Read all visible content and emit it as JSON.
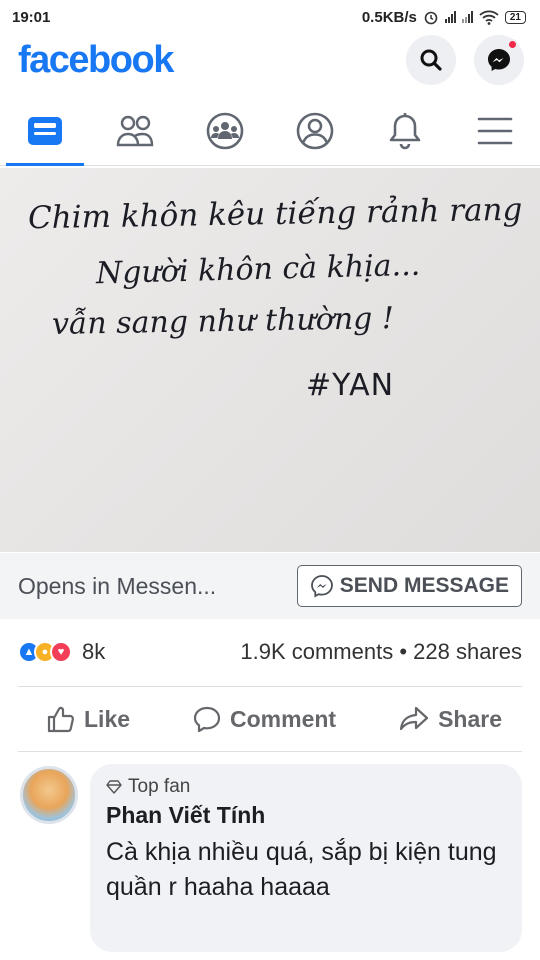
{
  "status_bar": {
    "time": "19:01",
    "speed": "0.5KB/s",
    "battery": "21"
  },
  "header": {
    "logo": "facebook",
    "brand_color": "#1877f2",
    "search_icon": "search-icon",
    "messenger_icon": "messenger-icon"
  },
  "tabs": [
    {
      "icon": "news-feed-icon",
      "active": true
    },
    {
      "icon": "friends-icon",
      "active": false
    },
    {
      "icon": "groups-icon",
      "active": false
    },
    {
      "icon": "profile-icon",
      "active": false
    },
    {
      "icon": "bell-icon",
      "active": false
    },
    {
      "icon": "menu-icon",
      "active": false
    }
  ],
  "post": {
    "image_text": {
      "line1": "Chim khôn kêu tiếng rảnh rang",
      "line2": "Người khôn cà khịa...",
      "line3": "vẫn sang như thường !",
      "signature": "#YAN"
    },
    "cta_text": "Opens in Messen...",
    "send_button": "SEND MESSAGE",
    "reaction_count": "8k",
    "comments_shares": "1.9K comments • 228 shares",
    "actions": {
      "like": "Like",
      "comment": "Comment",
      "share": "Share"
    }
  },
  "comment": {
    "badge": "Top fan",
    "author": "Phan Viết Tính",
    "text": "Cà khịa nhiều quá, sắp bị kiện tung quần r haaha haaaa"
  }
}
